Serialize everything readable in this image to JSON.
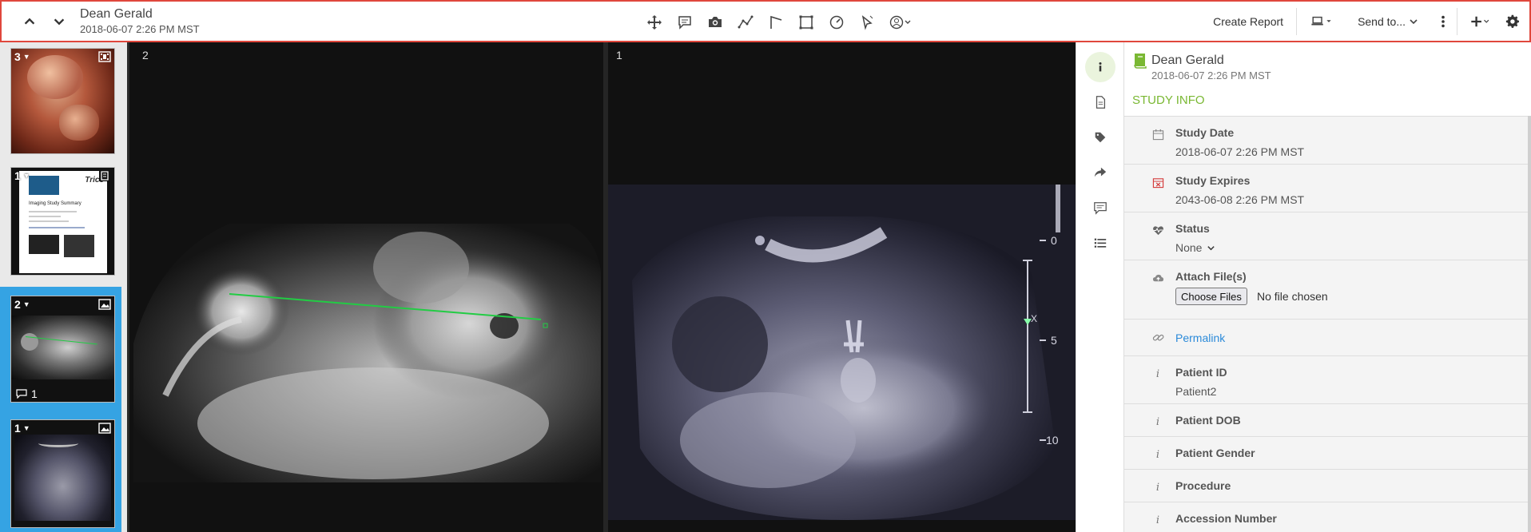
{
  "header": {
    "patient_name": "Dean Gerald",
    "study_datetime": "2018-06-07 2:26 PM MST",
    "create_report": "Create Report",
    "send_to": "Send to...",
    "tools": [
      "move-tool",
      "annotation-tool",
      "snapshot-tool",
      "polyline-tool",
      "angle-tool",
      "rectangle-tool",
      "ellipse-tool",
      "pointer-tool",
      "user-tool"
    ]
  },
  "thumbnails": [
    {
      "num": "3",
      "type": "film-icon",
      "note_count": ""
    },
    {
      "num": "1",
      "type": "report-icon",
      "note_count": ""
    },
    {
      "num": "2",
      "type": "image-icon",
      "note_count": "1"
    },
    {
      "num": "1",
      "type": "image-icon",
      "note_count": ""
    }
  ],
  "thumb_doc": {
    "brand": "Trice",
    "title": "Imaging Study Summary"
  },
  "viewer": {
    "left_pane_label": "2",
    "right_pane_label": "1",
    "scale": [
      "0",
      "X",
      "5",
      "10"
    ]
  },
  "panel": {
    "patient_name": "Dean Gerald",
    "study_datetime": "2018-06-07 2:26 PM MST",
    "section_title": "STUDY INFO",
    "study_date_label": "Study Date",
    "study_date_value": "2018-06-07 2:26 PM MST",
    "study_expires_label": "Study Expires",
    "study_expires_value": "2043-06-08 2:26 PM MST",
    "status_label": "Status",
    "status_value": "None",
    "attach_label": "Attach File(s)",
    "choose_files": "Choose Files",
    "no_file": "No file chosen",
    "permalink": "Permalink",
    "patient_id_label": "Patient ID",
    "patient_id_value": "Patient2",
    "patient_dob_label": "Patient DOB",
    "patient_gender_label": "Patient Gender",
    "procedure_label": "Procedure",
    "accession_label": "Accession Number"
  },
  "colors": {
    "accent_green": "#7ab833",
    "link_blue": "#2b8ad9",
    "active_thumb": "#35a3e3",
    "toolbar_highlight": "#e0473c",
    "measure_line": "#22cc44"
  }
}
